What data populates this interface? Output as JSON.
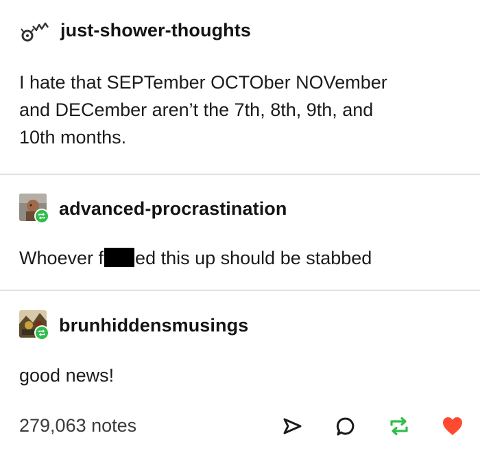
{
  "posts": [
    {
      "username": "just-shower-thoughts",
      "lines": [
        "I hate that SEPTember OCTOber NOVember",
        "and DECember aren’t the 7th, 8th, 9th, and",
        "10th months."
      ],
      "avatar_icon": "shower-thoughts-logo-icon"
    },
    {
      "username": "advanced-procrastination",
      "text_before": "Whoever f",
      "text_after": "ed this up should be stabbed",
      "avatar_icon": "user-avatar",
      "badge_icon": "reblog-icon"
    },
    {
      "username": "brunhiddensmusings",
      "text": "good news!",
      "avatar_icon": "user-avatar",
      "badge_icon": "reblog-icon"
    }
  ],
  "footer": {
    "notes": "279,063 notes",
    "actions": [
      "share-icon",
      "reply-icon",
      "reblog-icon",
      "like-icon"
    ]
  },
  "colors": {
    "reblog_green": "#2fbe4a",
    "like_red": "#ff4930",
    "divider": "#e2e2e2"
  }
}
